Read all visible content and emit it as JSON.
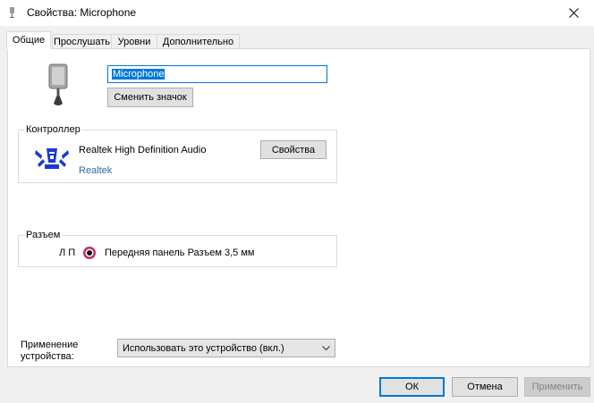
{
  "window": {
    "title": "Свойства: Microphone",
    "close_icon": "close-icon"
  },
  "tabs": [
    {
      "label": "Общие"
    },
    {
      "label": "Прослушать"
    },
    {
      "label": "Уровни"
    },
    {
      "label": "Дополнительно"
    }
  ],
  "general": {
    "device_name": "Microphone",
    "change_icon_label": "Сменить значок",
    "controller": {
      "group_label": "Контроллер",
      "name": "Realtek High Definition Audio",
      "vendor_link": "Realtek",
      "properties_label": "Свойства"
    },
    "jack": {
      "group_label": "Разъем",
      "channels": "Л П",
      "description": "Передняя панель Разъем 3,5 мм",
      "jack_color": "#c0306a"
    },
    "usage": {
      "label": "Применение устройства:",
      "selected": "Использовать это устройство (вкл.)"
    }
  },
  "buttons": {
    "ok": "ОК",
    "cancel": "Отмена",
    "apply": "Применить"
  },
  "colors": {
    "accent": "#0078d7",
    "link": "#3366aa"
  }
}
